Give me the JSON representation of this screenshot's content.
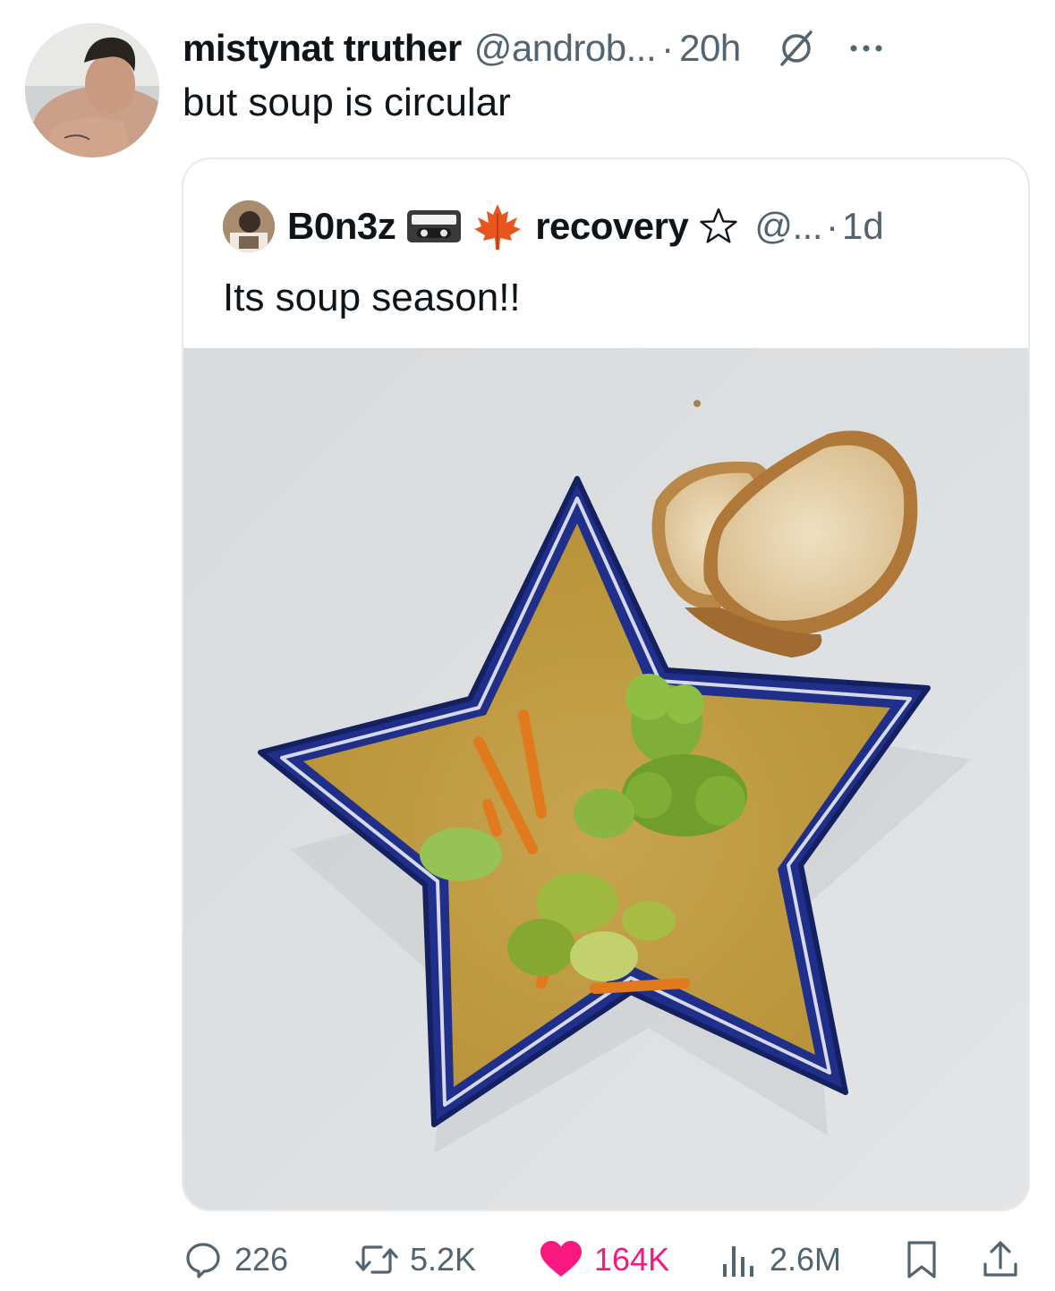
{
  "tweet": {
    "display_name": "mistynat truther",
    "handle": "@androb...",
    "dot": "·",
    "time": "20h",
    "text": "but soup is circular"
  },
  "quoted": {
    "display_name": "B0n3z",
    "name_suffix": "recovery",
    "handle": "@...",
    "dot": "·",
    "time": "1d",
    "text": "Its soup season!!"
  },
  "actions": {
    "replies": "226",
    "reposts": "5.2K",
    "likes": "164K",
    "views": "2.6M"
  },
  "colors": {
    "text": "#0f1419",
    "muted": "#536471",
    "like": "#f91880",
    "border": "#e7e9eb",
    "bowl_blue": "#1f2f8a"
  },
  "icons": [
    "grok-icon",
    "more-icon",
    "vhs-tape-icon",
    "maple-leaf-icon",
    "star-outline-icon",
    "reply-icon",
    "repost-icon",
    "heart-icon",
    "views-icon",
    "bookmark-icon",
    "share-icon"
  ]
}
